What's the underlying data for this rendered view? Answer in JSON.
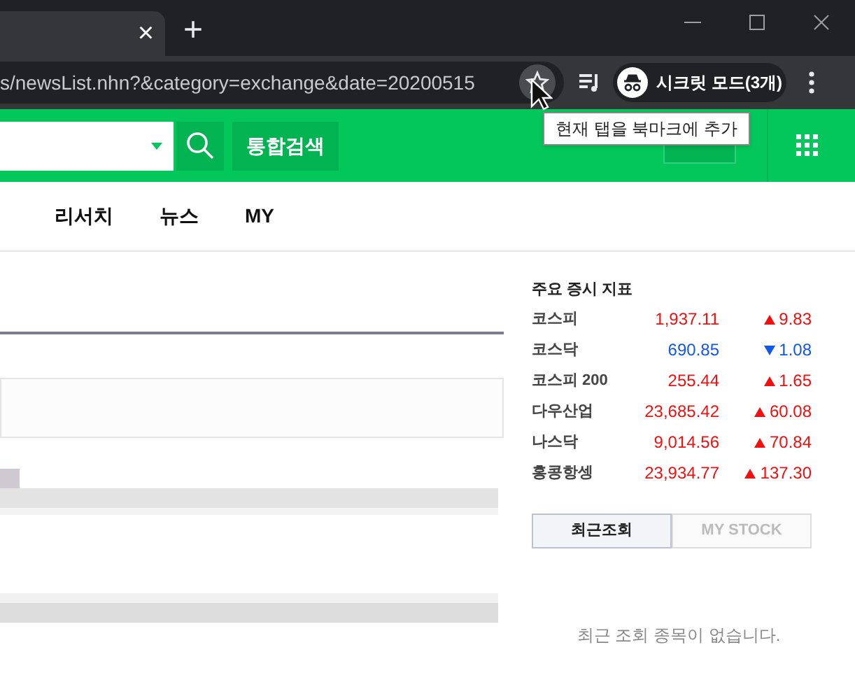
{
  "browser": {
    "tab_close": "×",
    "new_tab": "+",
    "url": "s/newsList.nhn?&category=exchange&date=20200515",
    "tooltip": "현재 탭을 북마크에 추가",
    "incognito": "시크릿 모드(3개)"
  },
  "header": {
    "search_button": "통합검색"
  },
  "nav": [
    {
      "label": "리서치"
    },
    {
      "label": "뉴스"
    },
    {
      "label": "MY"
    }
  ],
  "indices": {
    "title": "주요 증시 지표",
    "rows": [
      {
        "name": "코스피",
        "value": "1,937.11",
        "change": "9.83",
        "rising": true
      },
      {
        "name": "코스닥",
        "value": "690.85",
        "change": "1.08",
        "rising": false
      },
      {
        "name": "코스피 200",
        "value": "255.44",
        "change": "1.65",
        "rising": true
      },
      {
        "name": "다우산업",
        "value": "23,685.42",
        "change": "60.08",
        "rising": true
      },
      {
        "name": "나스닥",
        "value": "9,014.56",
        "change": "70.84",
        "rising": true
      },
      {
        "name": "홍콩항셍",
        "value": "23,934.77",
        "change": "137.30",
        "rising": true
      }
    ]
  },
  "recent_tabs": [
    {
      "label": "최근조회",
      "selected": true
    },
    {
      "label": "MY STOCK",
      "selected": false
    }
  ],
  "recent_empty": "최근 조회 종목이 없습니다."
}
